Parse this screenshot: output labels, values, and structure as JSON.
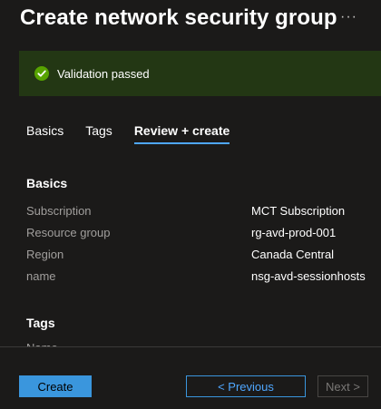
{
  "header": {
    "title": "Create network security group",
    "more_label": "···"
  },
  "banner": {
    "status": "success",
    "icon": "checkmark-circle-icon",
    "text": "Validation passed",
    "color": "#233714",
    "icon_color": "#57a300"
  },
  "tabs": [
    {
      "label": "Basics",
      "active": false
    },
    {
      "label": "Tags",
      "active": false
    },
    {
      "label": "Review + create",
      "active": true
    }
  ],
  "basics": {
    "title": "Basics",
    "rows": [
      {
        "label": "Subscription",
        "value": "MCT Subscription"
      },
      {
        "label": "Resource group",
        "value": "rg-avd-prod-001"
      },
      {
        "label": "Region",
        "value": "Canada Central"
      },
      {
        "label": "name",
        "value": "nsg-avd-sessionhosts"
      }
    ]
  },
  "tags": {
    "title": "Tags",
    "partial_row_label": "Name"
  },
  "footer": {
    "create_label": "Create",
    "previous_label": "< Previous",
    "next_label": "Next >",
    "next_disabled": true
  },
  "colors": {
    "accent": "#3a96dd",
    "background": "#1b1a19"
  }
}
